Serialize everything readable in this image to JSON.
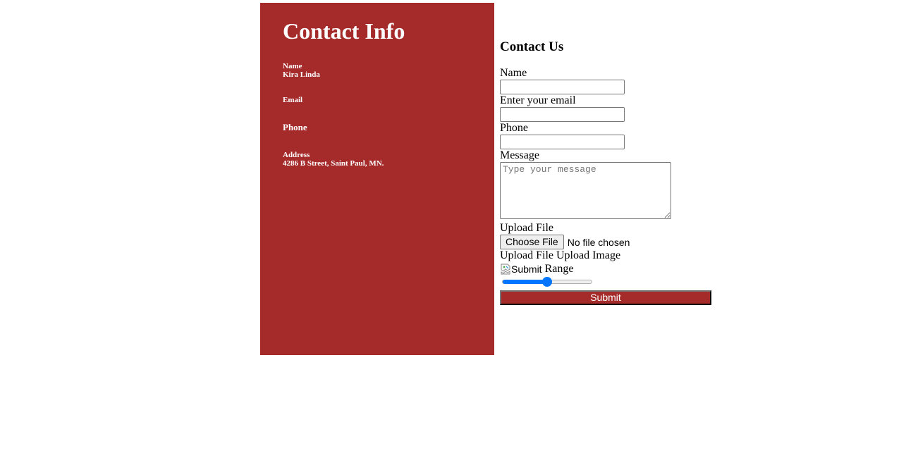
{
  "contact_info": {
    "title": "Contact Info",
    "name_label": "Name",
    "name_value": "Kira Linda",
    "email_label": "Email",
    "phone_label": "Phone",
    "address_label": "Address",
    "address_value": "4286 B Street, Saint Paul, MN."
  },
  "form": {
    "heading": "Contact Us",
    "name_label": "Name",
    "email_label": "Enter your email",
    "phone_label": "Phone",
    "message_label": "Message",
    "message_placeholder": "Type your message",
    "upload_label": "Upload File",
    "choose_file_button": "Choose File",
    "file_status": "No file chosen",
    "upload_image_label": "Upload File Upload Image",
    "image_alt": "Submit",
    "range_label": "Range",
    "range_value": 0.5,
    "submit_label": "Submit"
  },
  "colors": {
    "panel": "#a52a2a",
    "accent": "#0075ff"
  }
}
